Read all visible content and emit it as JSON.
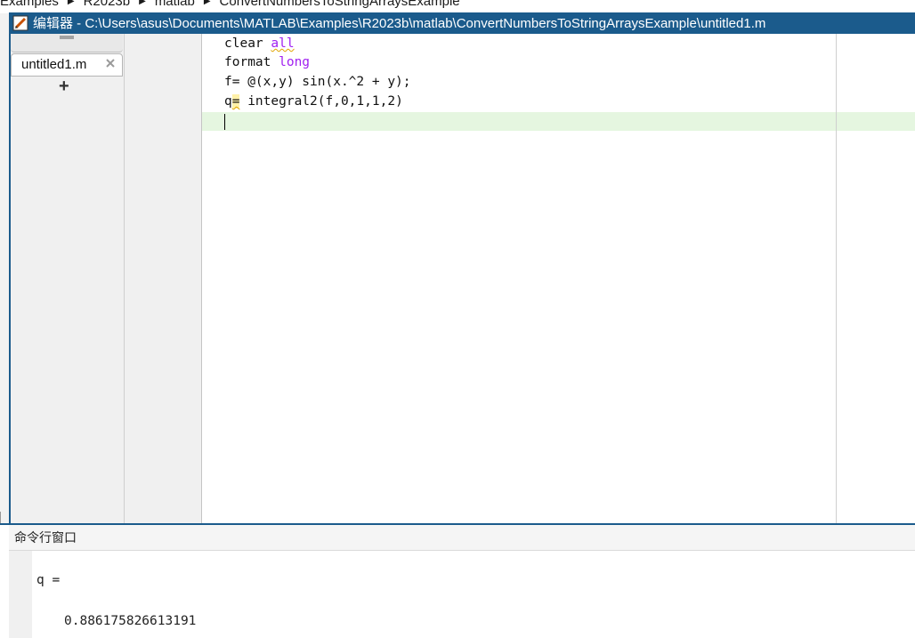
{
  "breadcrumb": {
    "items": [
      "Examples",
      "R2023b",
      "matlab",
      "ConvertNumbersToStringArraysExample"
    ]
  },
  "editor": {
    "title": "编辑器 - C:\\Users\\asus\\Documents\\MATLAB\\Examples\\R2023b\\matlab\\ConvertNumbersToStringArraysExample\\untitled1.m",
    "tab_label": "untitled1.m",
    "add_tab_label": "+",
    "code": {
      "line1_a": "clear ",
      "line1_b": "all",
      "line2_a": "format ",
      "line2_b": "long",
      "line3": "f= @(x,y) sin(x.^2 + y);",
      "line4_a": "q",
      "line4_b": "=",
      "line4_c": " integral2(f,0,1,1,2)"
    }
  },
  "command_window": {
    "title": "命令行窗口",
    "output_var": "q =",
    "output_value": "0.886175826613191"
  },
  "colors": {
    "accent": "#1b5b8c",
    "keyword": "#a020f0",
    "current_line": "#e5f6e0"
  }
}
